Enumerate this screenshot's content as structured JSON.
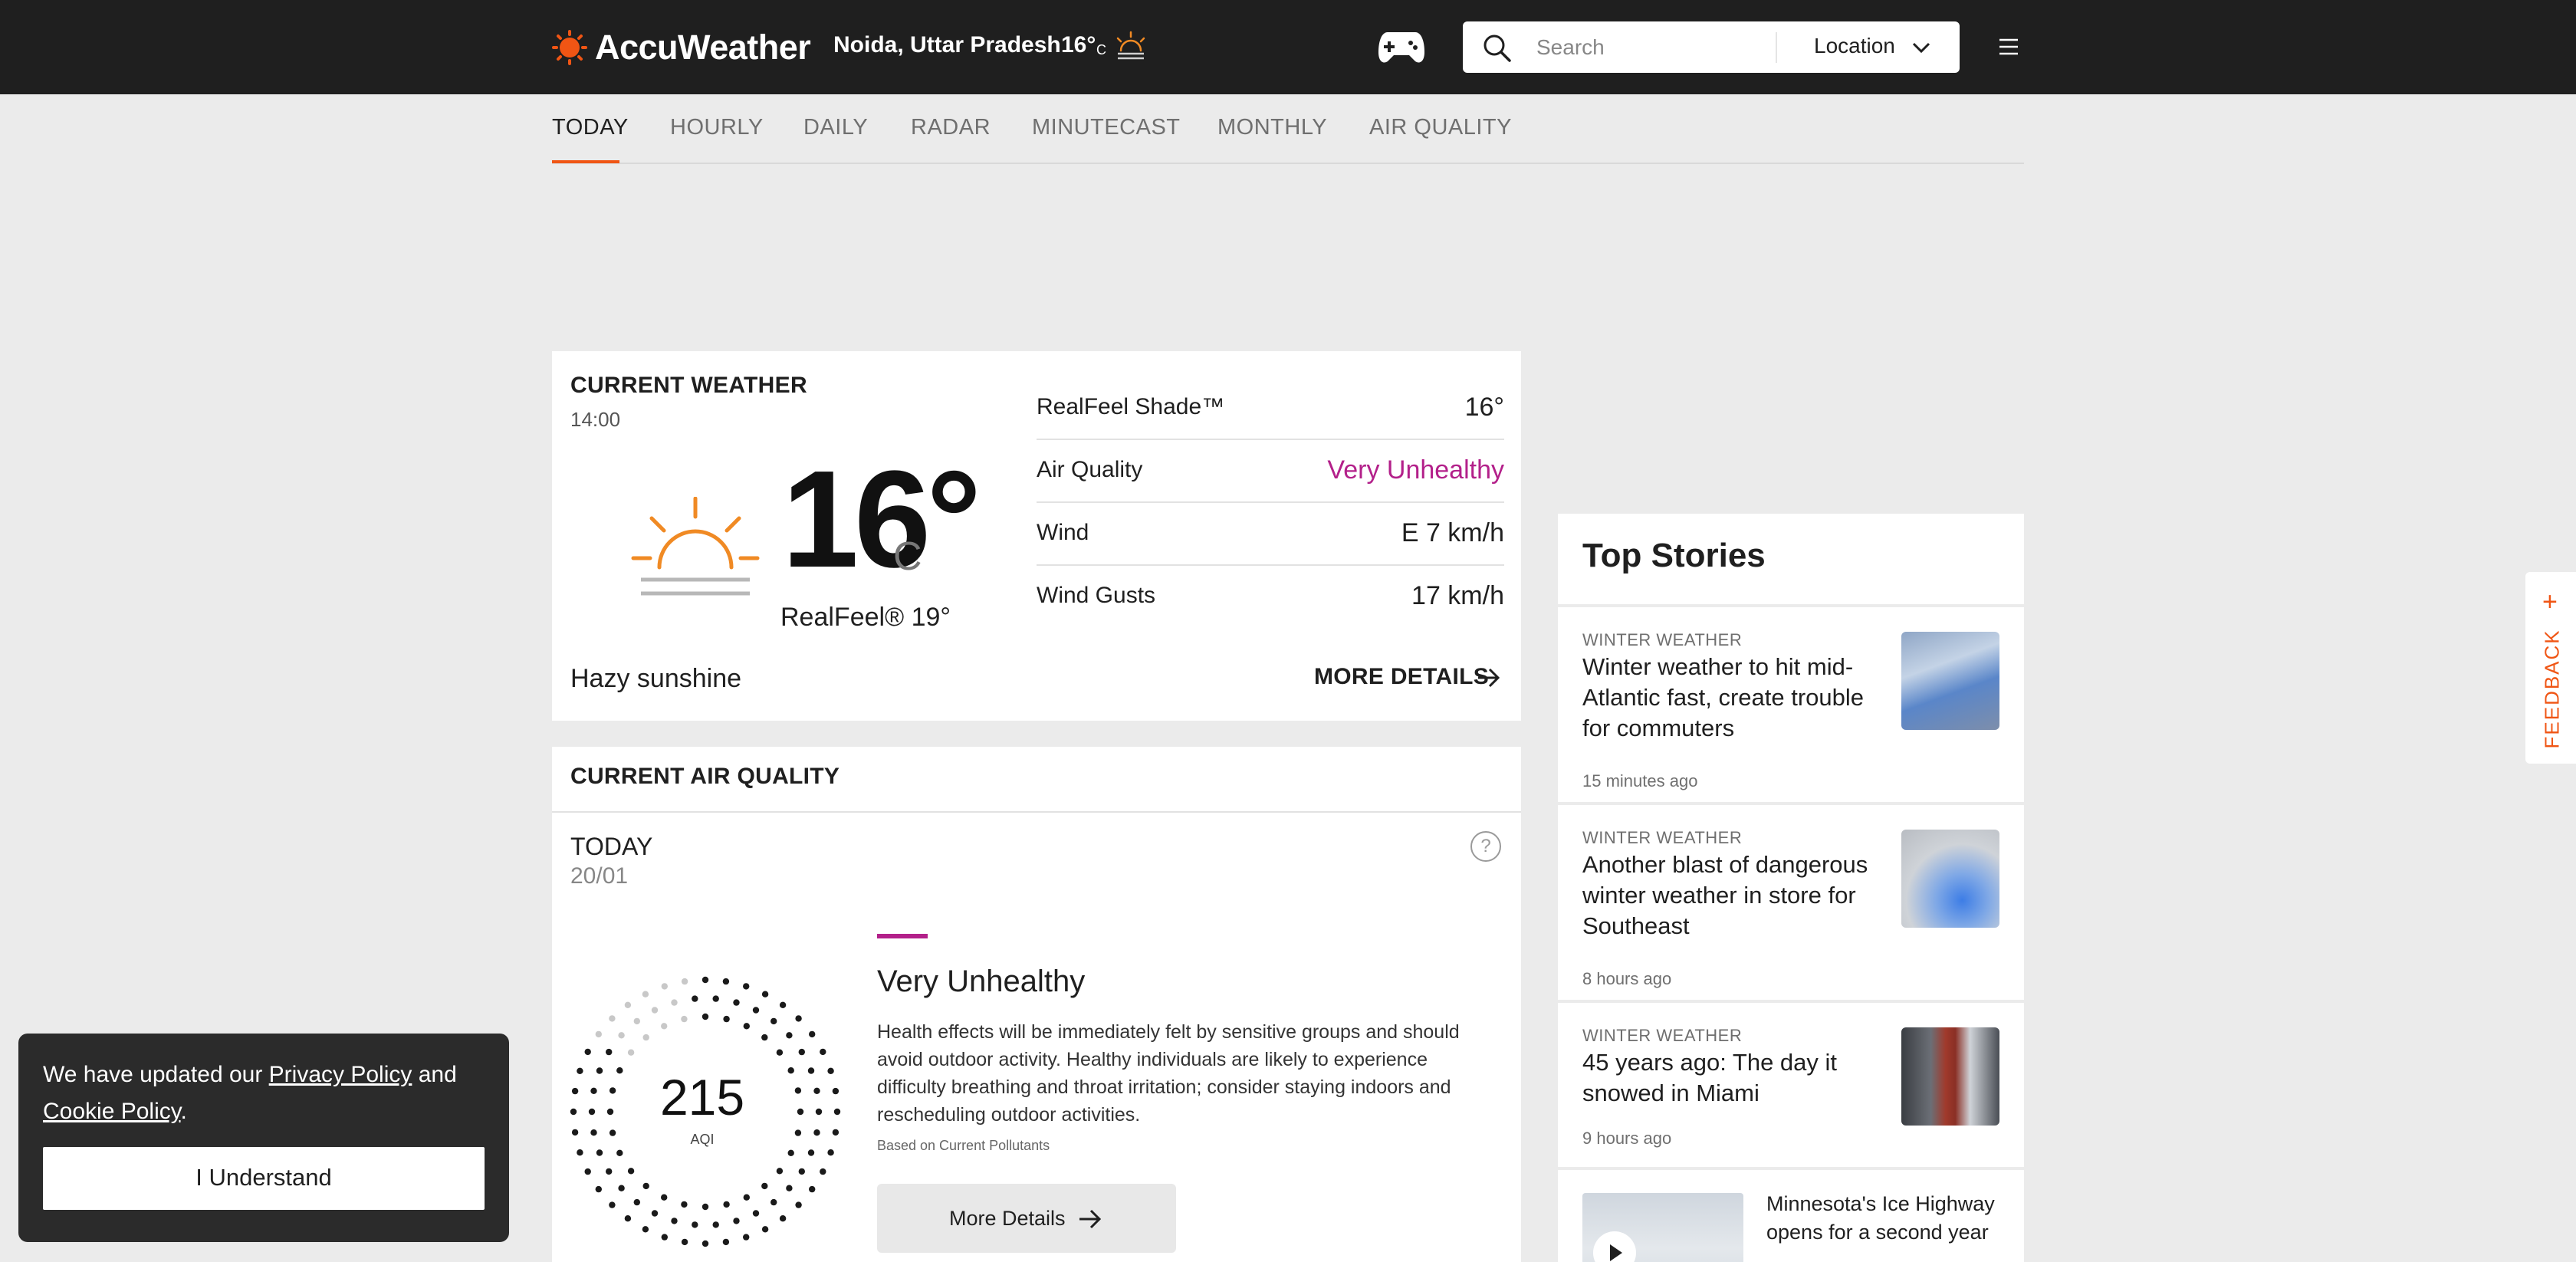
{
  "header": {
    "logo_text": "AccuWeather",
    "location_name": "Noida, Uttar Pradesh",
    "location_temp": "16°",
    "location_unit": "C",
    "search_placeholder": "Search",
    "location_button": "Location",
    "brand_color": "#f05514"
  },
  "tabs": [
    {
      "label": "TODAY",
      "active": true
    },
    {
      "label": "HOURLY"
    },
    {
      "label": "DAILY"
    },
    {
      "label": "RADAR"
    },
    {
      "label": "MINUTECAST"
    },
    {
      "label": "MONTHLY"
    },
    {
      "label": "AIR QUALITY"
    }
  ],
  "current_weather": {
    "title": "CURRENT WEATHER",
    "time": "14:00",
    "temp": "16°",
    "unit": "C",
    "realfeel": "RealFeel® 19°",
    "phrase": "Hazy sunshine",
    "more_details": "MORE DETAILS",
    "details": [
      {
        "label": "RealFeel Shade™",
        "value": "16°"
      },
      {
        "label": "Air Quality",
        "value": "Very Unhealthy"
      },
      {
        "label": "Wind",
        "value": "E 7 km/h"
      },
      {
        "label": "Wind Gusts",
        "value": "17 km/h"
      }
    ]
  },
  "air_quality": {
    "header": "CURRENT AIR QUALITY",
    "day": "TODAY",
    "date": "20/01",
    "help": "?",
    "aqi": "215",
    "aqi_label": "AQI",
    "category": "Very Unhealthy",
    "category_color": "#b3208a",
    "description": "Health effects will be immediately felt by sensitive groups and should avoid outdoor activity. Healthy individuals are likely to experience difficulty breathing and throat irritation; consider staying indoors and rescheduling outdoor activities.",
    "based_on": "Based on Current Pollutants",
    "button": "More Details"
  },
  "top_stories": {
    "title": "Top Stories",
    "stories": [
      {
        "category": "WINTER WEATHER",
        "title": "Winter weather to hit mid-Atlantic fast, create trouble for commuters",
        "time": "15 minutes ago"
      },
      {
        "category": "WINTER WEATHER",
        "title": "Another blast of dangerous winter weather in store for Southeast",
        "time": "8 hours ago"
      },
      {
        "category": "WINTER WEATHER",
        "title": "45 years ago: The day it snowed in Miami",
        "time": "9 hours ago"
      }
    ],
    "video_title": "Minnesota's Ice Highway opens for a second year"
  },
  "feedback": {
    "label": "FEEDBACK",
    "plus": "+"
  },
  "cookie": {
    "text_before": "We have updated our ",
    "privacy_link": "Privacy Policy",
    "text_and": " and ",
    "cookie_link": "Cookie Policy",
    "text_after": ".",
    "button": "I Understand"
  }
}
